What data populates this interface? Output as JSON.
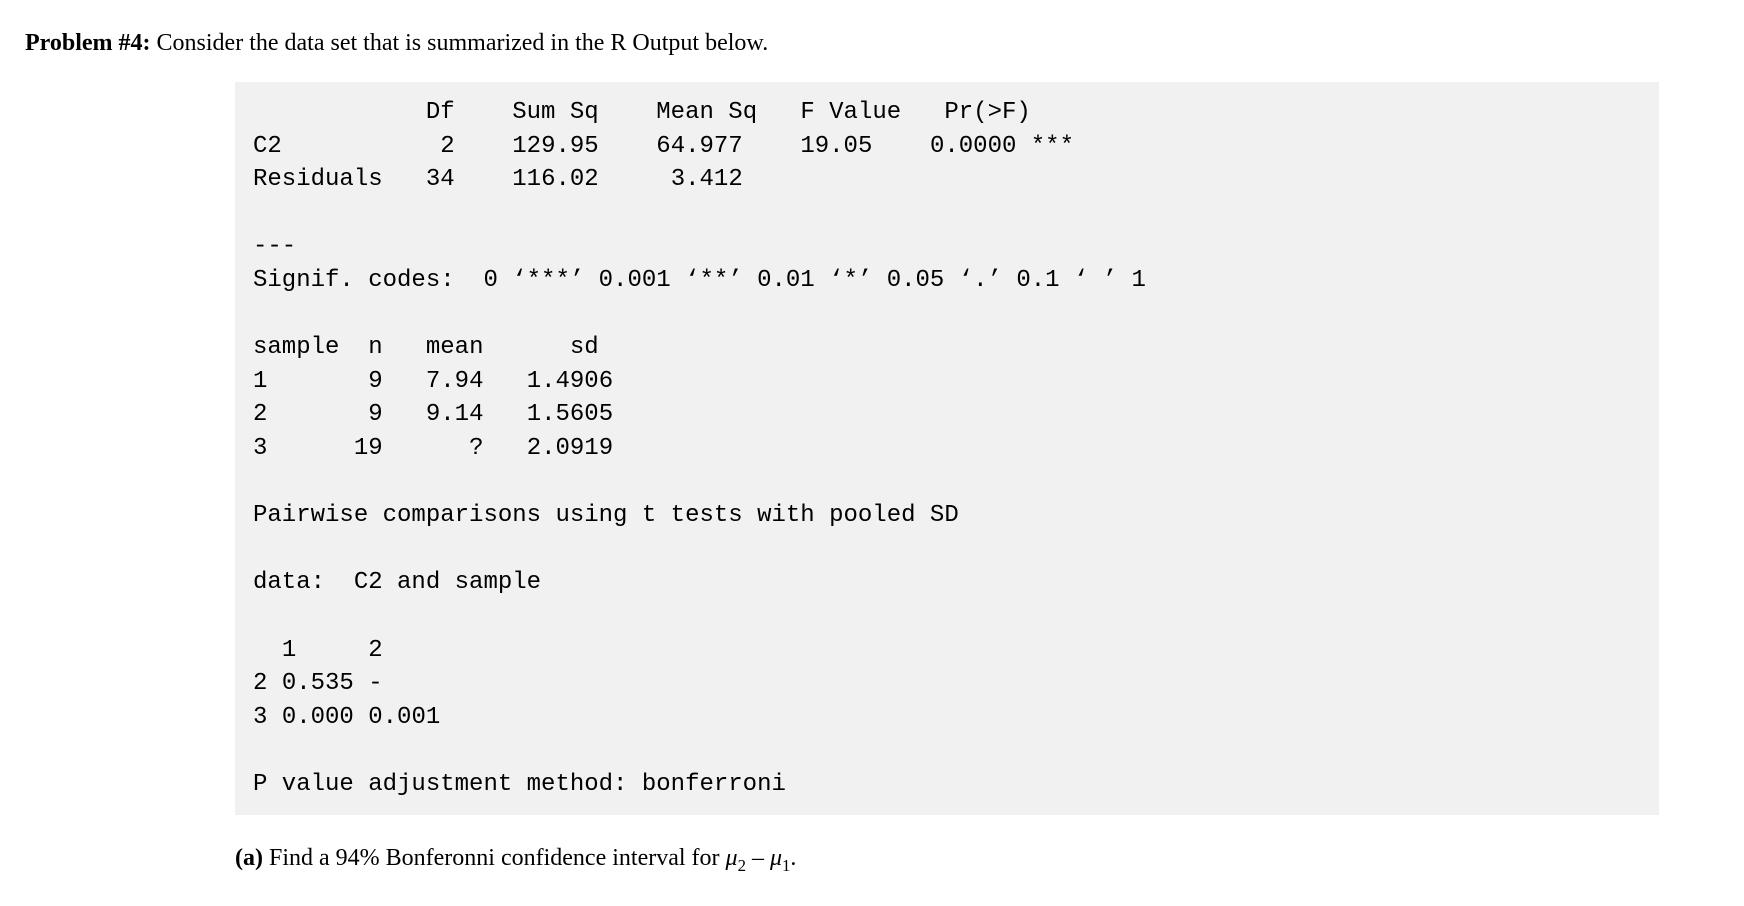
{
  "problem": {
    "label": "Problem #4:",
    "text": " Consider the data set that is summarized in the R Output below."
  },
  "anova": {
    "headers": {
      "df": "Df",
      "sumsq": "Sum Sq",
      "meansq": "Mean Sq",
      "fval": "F Value",
      "pr": "Pr(>F)"
    },
    "rows": [
      {
        "name": "C2",
        "df": "2",
        "sumsq": "129.95",
        "meansq": "64.977",
        "fval": "19.05",
        "pr": "0.0000 ***"
      },
      {
        "name": "Residuals",
        "df": "34",
        "sumsq": "116.02",
        "meansq": "3.412",
        "fval": "",
        "pr": ""
      }
    ]
  },
  "sep": "---",
  "signif": "Signif. codes:  0 ‘***’ 0.001 ‘**’ 0.01 ‘*’ 0.05 ‘.’ 0.1 ‘ ’ 1",
  "samples": {
    "headers": {
      "sample": "sample",
      "n": "n",
      "mean": "mean",
      "sd": "sd"
    },
    "rows": [
      {
        "sample": "1",
        "n": "9",
        "mean": "7.94",
        "sd": "1.4906"
      },
      {
        "sample": "2",
        "n": "9",
        "mean": "9.14",
        "sd": "1.5605"
      },
      {
        "sample": "3",
        "n": "19",
        "mean": "?",
        "sd": "2.0919"
      }
    ]
  },
  "pairwise_title": "Pairwise comparisons using t tests with pooled SD",
  "pairwise_data": "data:  C2 and sample",
  "pairwise_matrix": {
    "cols": [
      "1",
      "2"
    ],
    "rows": [
      {
        "label": "2",
        "vals": [
          "0.535",
          "-"
        ]
      },
      {
        "label": "3",
        "vals": [
          "0.000",
          "0.001"
        ]
      }
    ]
  },
  "pvalue_adjust": "P value adjustment method: bonferroni",
  "sub_question": {
    "label": "(a)",
    "text_before": " Find a 94% Bonferonni confidence interval for ",
    "mu2": "μ",
    "sub2": "2",
    "minus": " – ",
    "mu1": "μ",
    "sub1": "1",
    "period": "."
  }
}
